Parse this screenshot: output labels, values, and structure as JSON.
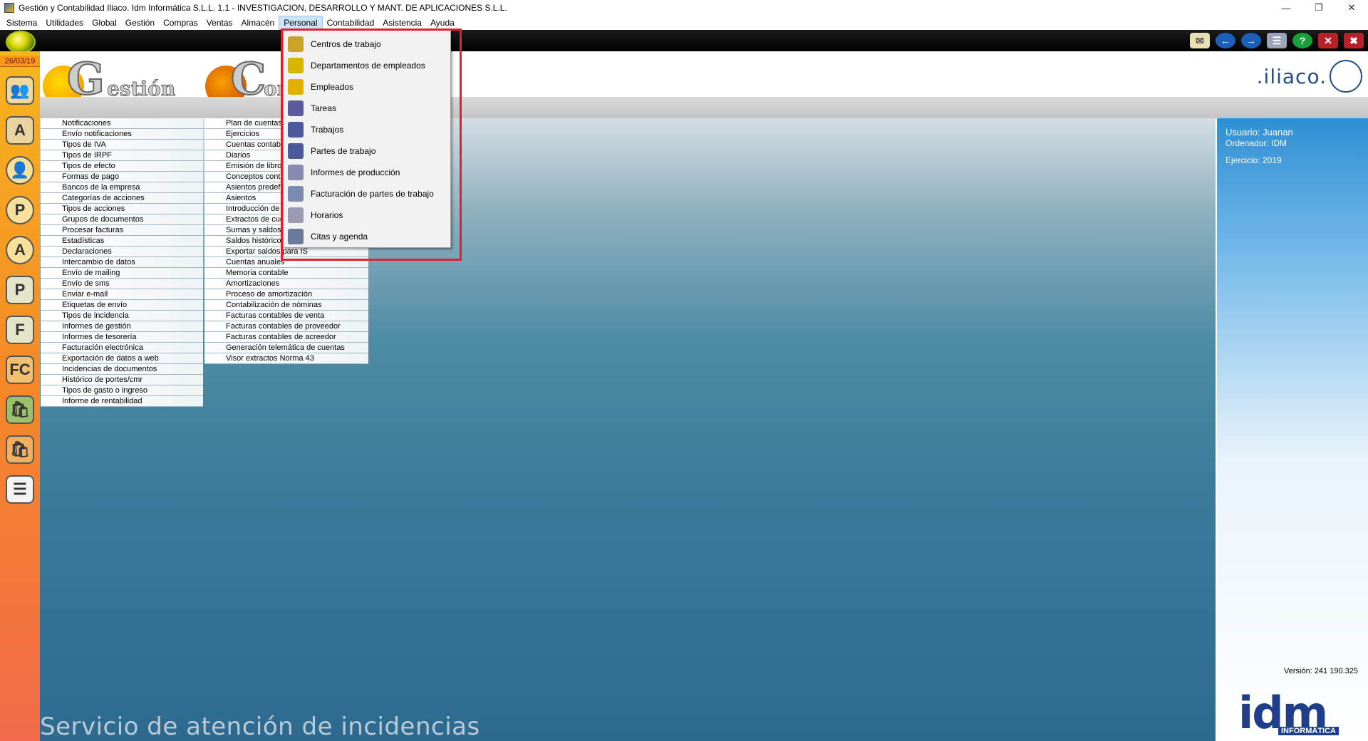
{
  "window": {
    "title": "Gestión y Contabilidad Iliaco. Idm Informática S.L.L. 1.1 - INVESTIGACION, DESARROLLO Y MANT. DE APLICACIONES S.L.L.",
    "controls": [
      "—",
      "❐",
      "✕"
    ]
  },
  "menubar": [
    "Sistema",
    "Utilidades",
    "Global",
    "Gestión",
    "Compras",
    "Ventas",
    "Almacén",
    "Personal",
    "Contabilidad",
    "Asistencia",
    "Ayuda"
  ],
  "active_menu": "Personal",
  "sidebar": {
    "date": "26/03/19"
  },
  "logos": {
    "gestion_letter": "G",
    "gestion_rest": "estión",
    "contab_letter": "C",
    "contab_rest": "on",
    "brand": ".iliaco."
  },
  "gestion_list": [
    "Notificaciones",
    "Envío notificaciones",
    "Tipos de IVA",
    "Tipos de IRPF",
    "Tipos de efecto",
    "Formas de pago",
    "Bancos de la empresa",
    "Categorías de acciones",
    "Tipos de acciones",
    "Grupos de documentos",
    "Procesar facturas",
    "Estadísticas",
    "Declaraciones",
    "Intercambio de datos",
    "Envío de mailing",
    "Envío de sms",
    "Enviar e-mail",
    "Etiquetas de envío",
    "Tipos de incidencia",
    "Informes de gestión",
    "Informes de tesorería",
    "Facturación electrónica",
    "Exportación de datos a web",
    "Incidencias de documentos",
    "Histórico de portes/cmr",
    "Tipos de gasto o ingreso",
    "Informe de rentabilidad"
  ],
  "contab_list": [
    "Plan de cuentas",
    "Ejercicios",
    "Cuentas contab",
    "Diarios",
    "Emisión de libro",
    "Conceptos cont",
    "Asientos predefi",
    "Asientos",
    "Introducción de",
    "Extractos de cue",
    "Sumas y saldos",
    "Saldos históricos",
    "Exportar saldos para IS",
    "Cuentas anuales",
    "Memoria contable",
    "Amortizaciones",
    "Proceso de amortización",
    "Contabilización de nóminas",
    "Facturas contables de venta",
    "Facturas contables de proveedor",
    "Facturas contables de acreedor",
    "Generación telemática de cuentas",
    "Visor extractos Norma 43"
  ],
  "personal_menu": [
    {
      "label": "Centros de trabajo",
      "icon": "building-icon",
      "color": "#c9a227"
    },
    {
      "label": "Departamentos de empleados",
      "icon": "department-icon",
      "color": "#d6b400"
    },
    {
      "label": "Empleados",
      "icon": "employee-icon",
      "color": "#e0b000"
    },
    {
      "label": "Tareas",
      "icon": "tasks-icon",
      "color": "#5a5a9c"
    },
    {
      "label": "Trabajos",
      "icon": "jobs-icon",
      "color": "#4a5a9c"
    },
    {
      "label": "Partes de trabajo",
      "icon": "work-report-icon",
      "color": "#4a5a9c"
    },
    {
      "label": "Informes de producción",
      "icon": "production-report-icon",
      "color": "#8a8ab0"
    },
    {
      "label": "Facturación de partes de trabajo",
      "icon": "billing-icon",
      "color": "#7a8ab0"
    },
    {
      "label": "Horarios",
      "icon": "schedule-icon",
      "color": "#9a9ab0"
    },
    {
      "label": "Citas y agenda",
      "icon": "clock-icon",
      "color": "#6a7a9a"
    }
  ],
  "user_info": {
    "usuario": "Usuario: Juanan",
    "ordenador": "Ordenador:  IDM",
    "ejercicio": "Ejercicio: 2019"
  },
  "version": "Versión: 241 190.325",
  "idm_logo": {
    "big": "idm",
    "small": "INFORMÁTICA"
  },
  "footer": "Servicio de atención de incidencias",
  "colors": {
    "accent": "#e0202f",
    "brand": "#234d87"
  }
}
